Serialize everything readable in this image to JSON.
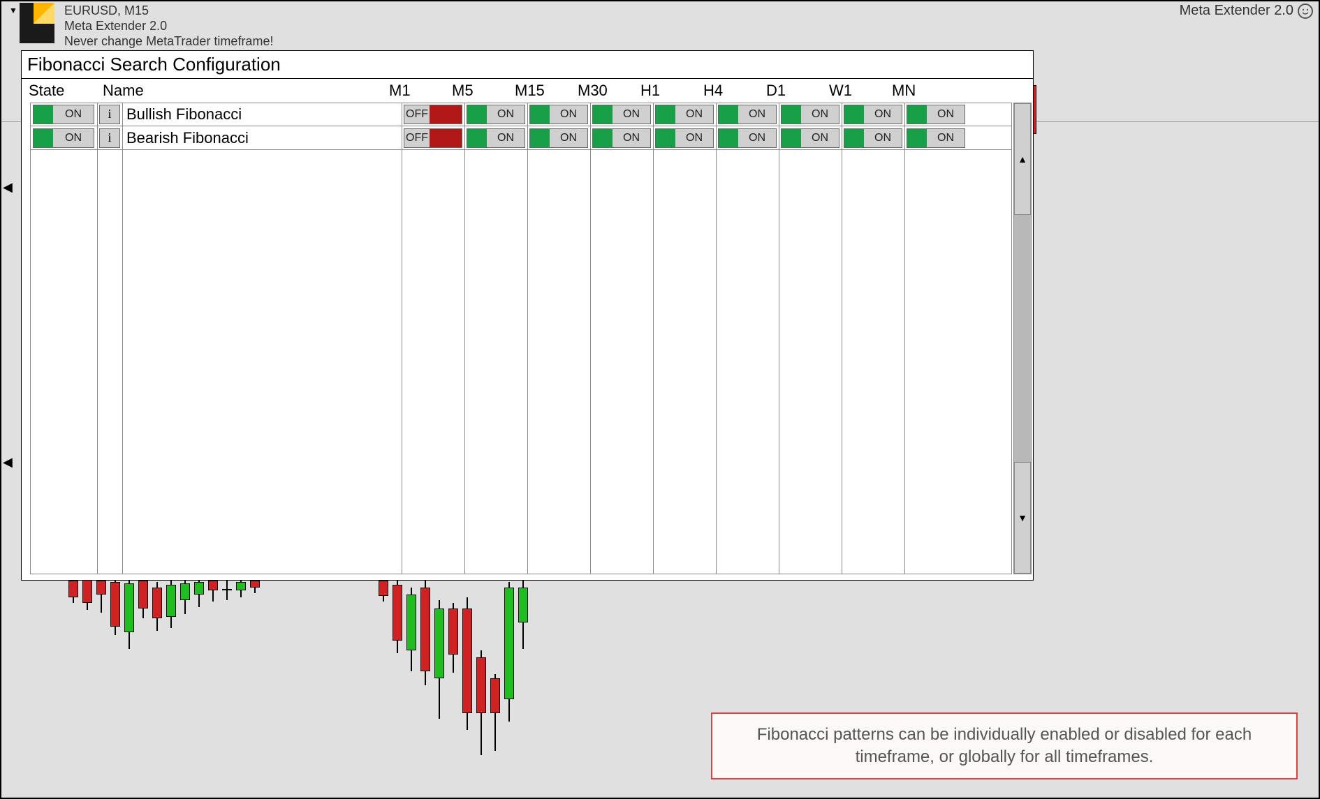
{
  "header": {
    "symbol": "EURUSD, M15",
    "product": "Meta Extender 2.0",
    "tagline": "Never change MetaTrader timeframe!",
    "right_badge": "Meta Extender 2.0"
  },
  "panel": {
    "title": "Fibonacci Search Configuration",
    "columns": {
      "state": "State",
      "name": "Name"
    },
    "timeframes": [
      "M1",
      "M5",
      "M15",
      "M30",
      "H1",
      "H4",
      "D1",
      "W1",
      "MN"
    ],
    "rows": [
      {
        "name": "Bullish Fibonacci",
        "state": "ON",
        "info": "i",
        "tf_states": [
          "OFF",
          "ON",
          "ON",
          "ON",
          "ON",
          "ON",
          "ON",
          "ON",
          "ON"
        ]
      },
      {
        "name": "Bearish Fibonacci",
        "state": "ON",
        "info": "i",
        "tf_states": [
          "OFF",
          "ON",
          "ON",
          "ON",
          "ON",
          "ON",
          "ON",
          "ON",
          "ON"
        ]
      }
    ]
  },
  "note": "Fibonacci patterns can be individually enabled or disabled for each timeframe, or globally for all timeframes.",
  "labels": {
    "on": "ON",
    "off": "OFF"
  }
}
